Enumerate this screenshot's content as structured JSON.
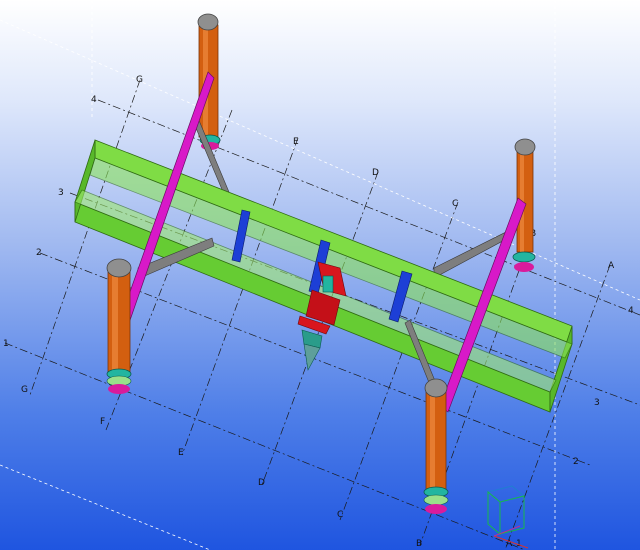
{
  "grid_labels": {
    "letters_far": [
      "G",
      "E",
      "D",
      "C",
      "A"
    ],
    "letters_near": [
      "G",
      "F",
      "E",
      "D",
      "C",
      "B",
      "A"
    ],
    "letter_mid": [
      "F",
      "B"
    ],
    "numbers_left": [
      "4",
      "3",
      "2",
      "1"
    ],
    "numbers_right": [
      "4",
      "3",
      "2",
      "1"
    ]
  },
  "colors": {
    "frame": "#66cc33",
    "columns": "#d35f10",
    "brace": "#d819c8",
    "beam": "#1d3fd6",
    "block": "#d8161e",
    "column_cap": "#8f8f8f",
    "base": "#22b5a0",
    "base_plate": "#d91b9c",
    "brace_steel": "#777777"
  },
  "icons": [
    "view-cube-icon"
  ]
}
